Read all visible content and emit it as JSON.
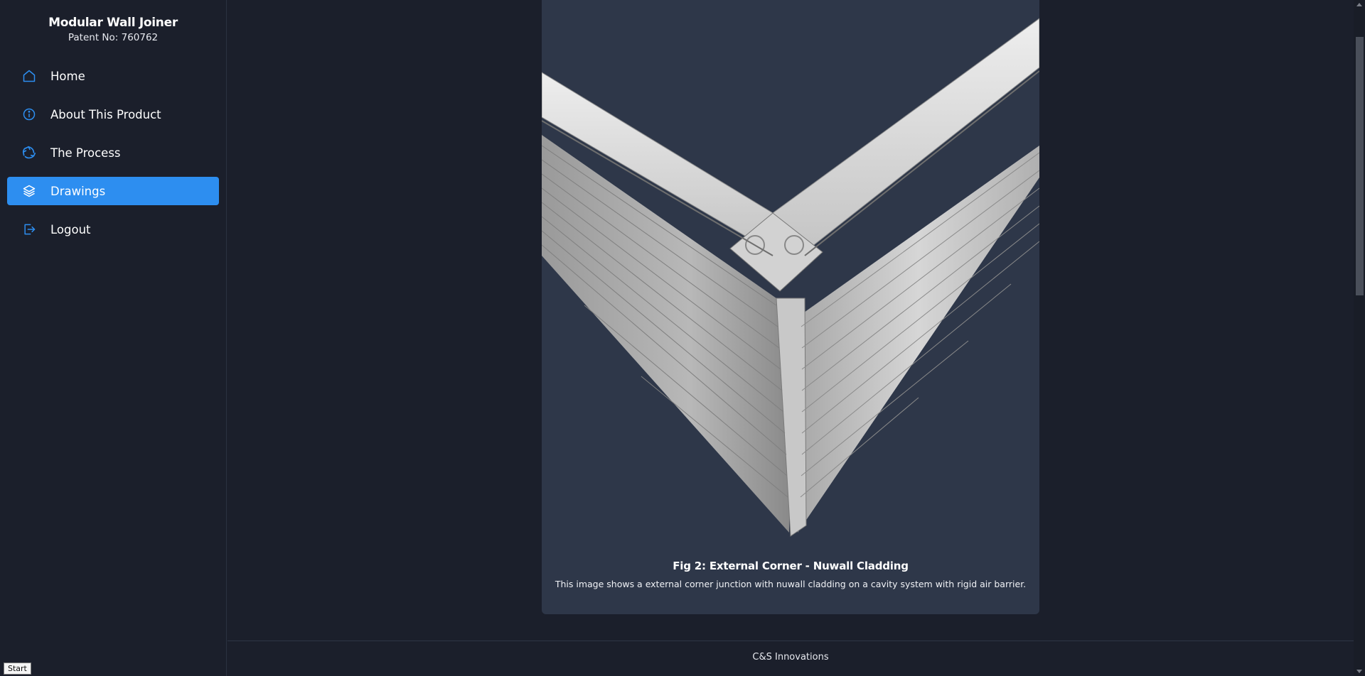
{
  "sidebar": {
    "title": "Modular Wall Joiner",
    "subtitle": "Patent No: 760762",
    "items": [
      {
        "label": "Home",
        "icon": "home-icon"
      },
      {
        "label": "About This Product",
        "icon": "info-icon"
      },
      {
        "label": "The Process",
        "icon": "recycle-icon"
      },
      {
        "label": "Drawings",
        "icon": "layers-icon",
        "active": true
      },
      {
        "label": "Logout",
        "icon": "logout-icon"
      }
    ]
  },
  "main": {
    "figure": {
      "title": "Fig 2: External Corner - Nuwall Cladding",
      "description": "This image shows a external corner junction with nuwall cladding on a cavity system with rigid air barrier."
    }
  },
  "footer": {
    "text": "C&S Innovations"
  },
  "tooltip": {
    "text": "Start"
  },
  "colors": {
    "accent": "#2d8ef0",
    "background": "#1b1f2b",
    "card": "#2e3749"
  }
}
